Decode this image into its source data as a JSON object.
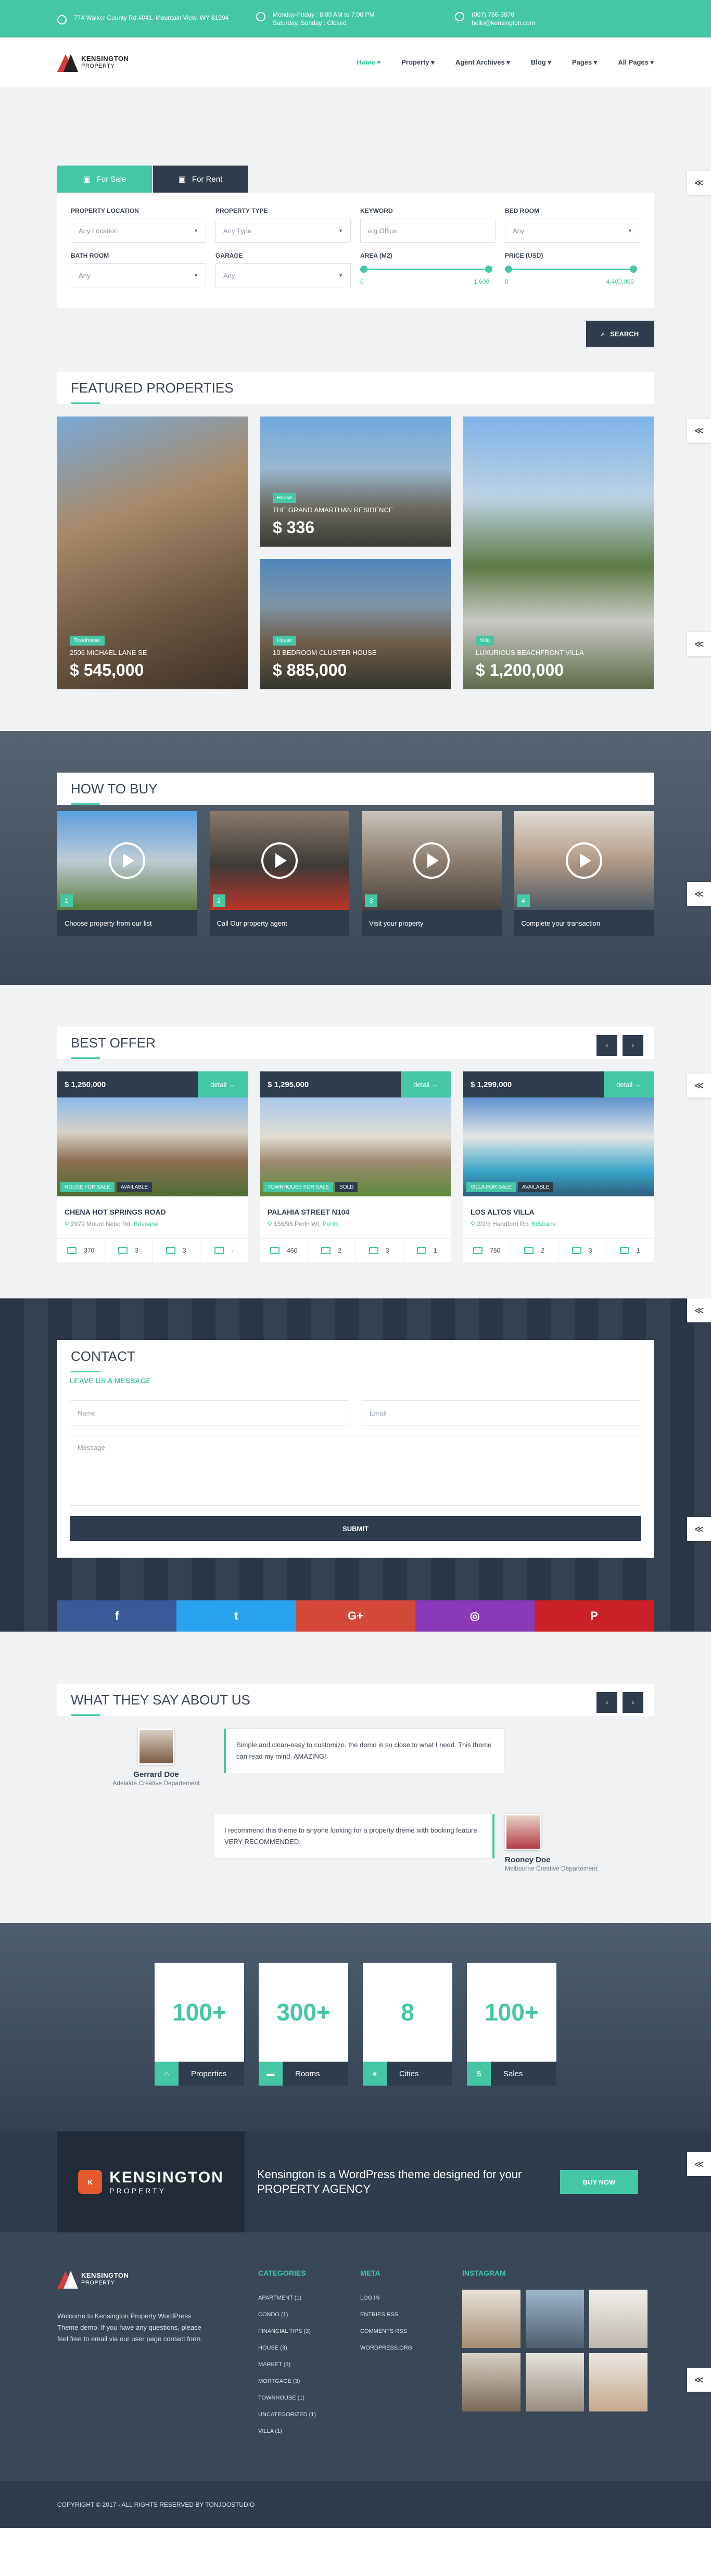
{
  "topbar": {
    "address": "774 Walker County Rd #041, Mountain View, WY 81904",
    "hours": "Monday-Friday : 8:00 AM to 7:00 PM\nSaturday, Sunday : Closed",
    "phone": "(007) 786-3876",
    "email": "hello@kensington.com"
  },
  "logo": {
    "name": "KENSINGTON",
    "sub": "PROPERTY"
  },
  "nav": [
    "Home ▾",
    "Property ▾",
    "Agent Archives ▾",
    "Blog ▾",
    "Pages ▾",
    "All Pages ▾"
  ],
  "search": {
    "tabs": [
      "For Sale",
      "For Rent"
    ],
    "fields": [
      {
        "label": "PROPERTY LOCATION",
        "value": "Any Location"
      },
      {
        "label": "PROPERTY TYPE",
        "value": "Any Type"
      },
      {
        "label": "KEYWORD",
        "value": "e.g.Office"
      },
      {
        "label": "BED ROOM",
        "value": "Any"
      },
      {
        "label": "BATH ROOM",
        "value": "Any"
      },
      {
        "label": "GARAGE",
        "value": "Any"
      }
    ],
    "area": {
      "label": "AREA (M2)",
      "min": "0",
      "max": "1,600"
    },
    "price": {
      "label": "PRICE (USD)",
      "min": "0",
      "max": "4,400,000"
    },
    "button": "SEARCH"
  },
  "featured": {
    "title": "FEATURED PROPERTIES",
    "items": [
      {
        "badge": "Townhouse",
        "address": "2506 MICHAEL LANE SE",
        "price": "$ 545,000"
      },
      {
        "badge": "House",
        "address": "THE GRAND AMARTHAN RESIDENCE",
        "price": "$ 336"
      },
      {
        "badge": "House",
        "address": "10 BEDROOM CLUSTER HOUSE",
        "price": "$ 885,000"
      },
      {
        "badge": "Villa",
        "address": "LUXURIOUS BEACHFRONT VILLA",
        "price": "$ 1,200,000"
      }
    ]
  },
  "howbuy": {
    "title": "HOW TO BUY",
    "steps": [
      {
        "n": "1",
        "text": "Choose property from our list"
      },
      {
        "n": "2",
        "text": "Call Our property agent"
      },
      {
        "n": "3",
        "text": "Visit your property"
      },
      {
        "n": "4",
        "text": "Complete your transaction"
      }
    ]
  },
  "offer": {
    "title": "BEST OFFER",
    "detail": "detail →",
    "items": [
      {
        "price": "$ 1,250,000",
        "tag1": "HOUSE FOR SALE",
        "tag2": "AVAILABLE",
        "name": "CHENA HOT SPRINGS ROAD",
        "addr": "2979 Mount Nebo Rd, ",
        "city": "Brisbane",
        "area": "370",
        "bed": "3",
        "bath": "3",
        "garage": "-"
      },
      {
        "price": "$ 1,295,000",
        "tag1": "TOWNHOUSE FOR SALE",
        "tag2": "SOLD",
        "name": "PALAHIA STREET N104",
        "addr": "156/95 Perth WI, ",
        "city": "Perth",
        "area": "460",
        "bed": "2",
        "bath": "3",
        "garage": "1"
      },
      {
        "price": "$ 1,299,000",
        "tag1": "VILLA FOR SALE",
        "tag2": "AVAILABLE",
        "name": "LOS ALTOS VILLA",
        "addr": "2/2/3 Handford Rd, ",
        "city": "Brisbane",
        "area": "760",
        "bed": "2",
        "bath": "3",
        "garage": "1"
      }
    ]
  },
  "contact": {
    "title": "CONTACT",
    "sub": "LEAVE US A MESSAGE",
    "name_ph": "Name",
    "email_ph": "Email",
    "msg_ph": "Message",
    "submit": "SUBMIT"
  },
  "social": [
    "f",
    "t",
    "G+",
    "◎",
    "P"
  ],
  "testimonials": {
    "title": "WHAT THEY SAY ABOUT US",
    "items": [
      {
        "text": "Simple and clean-easy to customize, the demo is so close to what I need. This theme can read my mind. AMAZING!",
        "name": "Gerrard Doe",
        "role": "Adelaide Creative Departement"
      },
      {
        "text": "I recommend this theme to anyone looking for a property theme with booking feature. VERY RECOMMENDED.",
        "name": "Rooney Doe",
        "role": "Melbourne Creative Departement"
      }
    ]
  },
  "stats": [
    {
      "n": "100+",
      "label": "Properties",
      "icon": "⌂"
    },
    {
      "n": "300+",
      "label": "Rooms",
      "icon": "▬"
    },
    {
      "n": "8",
      "label": "Cities",
      "icon": "●"
    },
    {
      "n": "100+",
      "label": "Sales",
      "icon": "$"
    }
  ],
  "cta": {
    "name": "KENSINGTON",
    "sub": "PROPERTY",
    "text": "Kensington is a WordPress theme designed for your PROPERTY AGENCY",
    "button": "BUY NOW"
  },
  "footer": {
    "about": "Welcome to Kensington Property WordPress Theme demo. If you have any questions, please feel free to email via our user page contact form.",
    "cat_title": "CATEGORIES",
    "categories": [
      "APARTMENT (1)",
      "CONDO (1)",
      "FINANCIAL TIPS (3)",
      "HOUSE (3)",
      "MARKET (3)",
      "MORTGAGE (3)",
      "TOWNHOUSE (1)",
      "UNCATEGORIZED (1)",
      "VILLA (1)"
    ],
    "meta_title": "META",
    "meta": [
      "LOG IN",
      "ENTRIES RSS",
      "COMMENTS RSS",
      "WORDPRESS.ORG"
    ],
    "insta_title": "INSTAGRAM",
    "copyright": "COPYRIGHT © 2017 - ALL RIGHTS RESERVED BY TONJOOSTUDIO"
  },
  "colors": {
    "accent": "#45c7a6",
    "dark": "#2f3c4c"
  }
}
